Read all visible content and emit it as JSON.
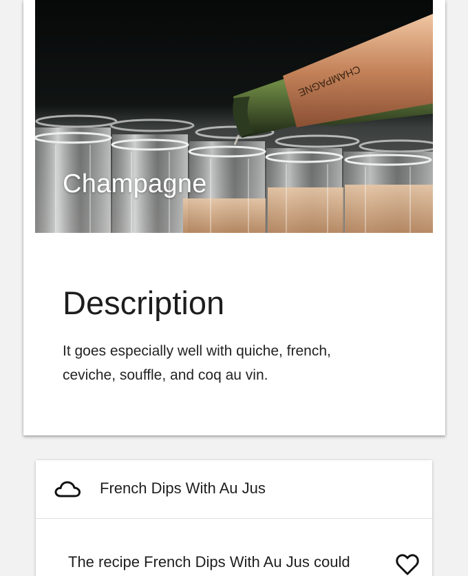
{
  "hero": {
    "title": "Champagne",
    "image_alt": "champagne-pouring-image",
    "bottle_label": "CHAMPAGNE"
  },
  "description": {
    "heading": "Description",
    "text": "It goes especially well with quiche, french, ceviche, souffle, and coq au vin."
  },
  "recipe": {
    "icon": "cloud-icon",
    "title": "French Dips With Au Jus",
    "body_text": "The recipe French Dips With Au Jus could",
    "favorite_icon": "heart-outline-icon"
  },
  "colors": {
    "background": "#f2f2f2",
    "card": "#ffffff",
    "text": "#1d1d1d",
    "hero_dark": "#0a0c0b",
    "bottle_foil": "#c98a62"
  }
}
